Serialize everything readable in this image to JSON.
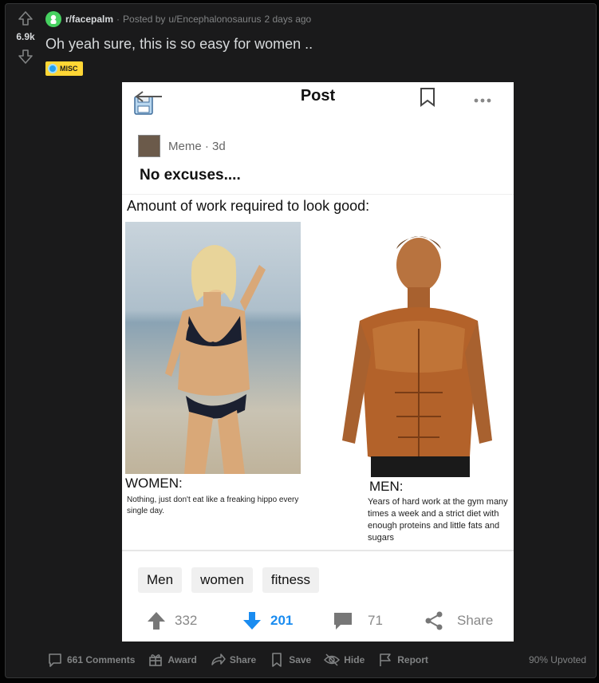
{
  "post": {
    "vote_count": "6.9k",
    "subreddit": "r/facepalm",
    "meta_dot": "·",
    "posted_by_prefix": "Posted by",
    "author": "u/Encephalonosaurus",
    "time_ago": "2 days ago",
    "title": "Oh yeah sure, this is so easy for women ..",
    "flair": "MISC"
  },
  "embed": {
    "header_title": "Post",
    "author_line": "Meme · 3d",
    "post_title": "No excuses....",
    "meme": {
      "heading": "Amount of work required to look good:",
      "women_label": "WOMEN:",
      "women_text": "Nothing, just don't eat like a freaking hippo every single day.",
      "men_label": "MEN:",
      "men_text": "Years of hard work at the gym many times a week and a strict diet with enough proteins and little fats and sugars"
    },
    "tags": [
      "Men",
      "women",
      "fitness"
    ],
    "actions": {
      "upvotes": "332",
      "downvotes": "201",
      "comments": "71",
      "share": "Share"
    }
  },
  "bottom_bar": {
    "comments": "661 Comments",
    "award": "Award",
    "share": "Share",
    "save": "Save",
    "hide": "Hide",
    "report": "Report",
    "upvoted": "90% Upvoted"
  },
  "colors": {
    "background": "#030303",
    "card": "#1a1a1b",
    "text": "#d7dadc",
    "muted": "#818384",
    "flair_bg": "#ffd635",
    "downvote_blue": "#1a8cf0"
  }
}
